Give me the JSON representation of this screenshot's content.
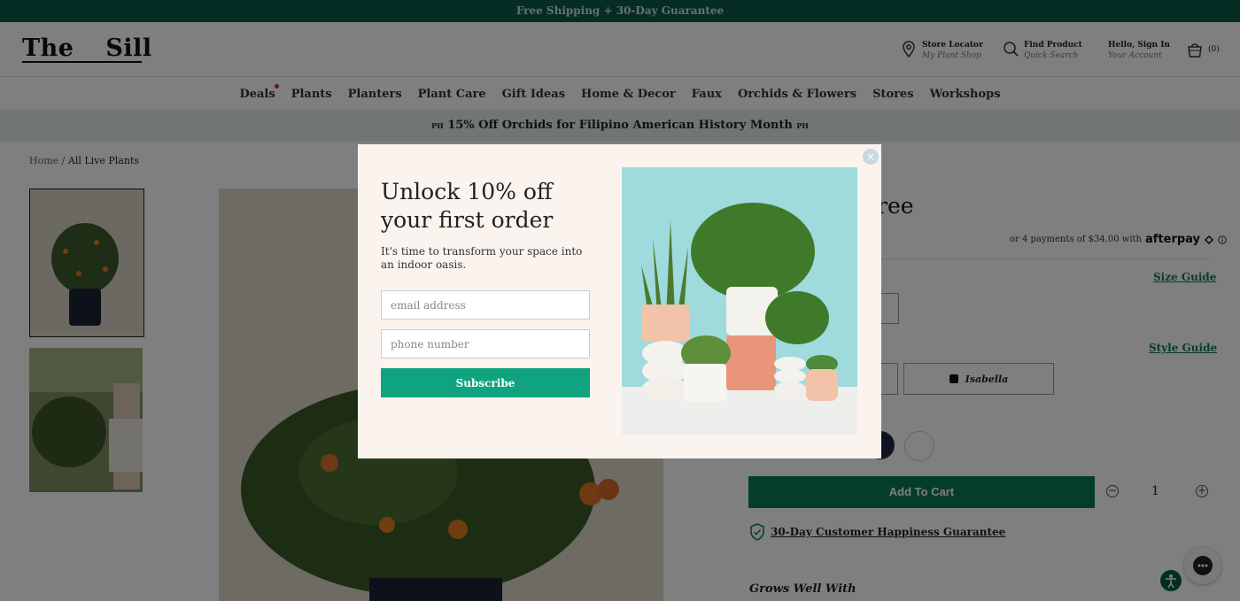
{
  "top_banner": {
    "text": "Free Shipping + 30-Day Guarantee"
  },
  "header": {
    "logo_left": "The",
    "logo_right": "Sill",
    "store_locator": {
      "title": "Store Locator",
      "subtitle": "My Plant Shop",
      "icon": "map-pin-icon"
    },
    "find_product": {
      "title": "Find Product",
      "subtitle": "Quick Search",
      "icon": "search-icon"
    },
    "account": {
      "title": "Hello, Sign In",
      "subtitle": "Your Account"
    },
    "cart": {
      "count": "(0)",
      "icon": "basket-icon"
    }
  },
  "nav": {
    "items": [
      "Deals",
      "Plants",
      "Planters",
      "Plant Care",
      "Gift Ideas",
      "Home & Decor",
      "Faux",
      "Orchids & Flowers",
      "Stores",
      "Workshops"
    ]
  },
  "promo": {
    "badge": "PH",
    "text": "15% Off Orchids for Filipino American History Month"
  },
  "breadcrumb": {
    "home": "Home",
    "separator": "/",
    "current": "All Live Plants"
  },
  "product": {
    "title_fragment": "ree",
    "afterpay_text": "or 4 payments of $34.00 with",
    "afterpay_brand": "afterpay",
    "size_guide": "Size Guide",
    "style_guide": "Style Guide",
    "style_selected": "Isabella",
    "add_to_cart": "Add To Cart",
    "quantity": "1",
    "guarantee": "30-Day Customer Happiness Guarantee",
    "grows_well_with": "Grows Well With"
  },
  "modal": {
    "title": "Unlock 10% off your first order",
    "subtitle": "It's time to transform your space into an indoor oasis.",
    "email_placeholder": "email address",
    "phone_placeholder": "phone number",
    "subscribe": "Subscribe",
    "close": "×"
  },
  "colors": {
    "banner": "#0b5a46",
    "accent": "#10a37f",
    "cart_button": "#0b7a5a",
    "modal_bg": "#fbf3ee",
    "promo_bg": "#e3ede8"
  }
}
